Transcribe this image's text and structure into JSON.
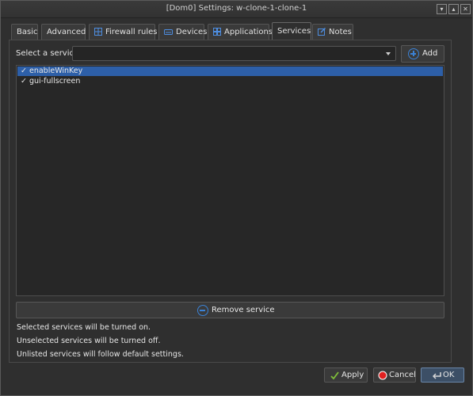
{
  "window": {
    "title": "[Dom0] Settings: w-clone-1-clone-1",
    "controls": [
      "minimize-icon",
      "maximize-icon",
      "close-icon"
    ]
  },
  "tabs": [
    {
      "label": "Basic",
      "icon": null
    },
    {
      "label": "Advanced",
      "icon": null
    },
    {
      "label": "Firewall rules",
      "icon": "firewall-icon"
    },
    {
      "label": "Devices",
      "icon": "devices-icon"
    },
    {
      "label": "Applications",
      "icon": "applications-icon"
    },
    {
      "label": "Services",
      "icon": null,
      "active": true
    },
    {
      "label": "Notes",
      "icon": "notes-icon"
    }
  ],
  "services": {
    "select_label": "Select a service:",
    "select_value": "",
    "add_label": "Add",
    "items": [
      {
        "name": "enableWinKey",
        "checked": true,
        "selected": true
      },
      {
        "name": "gui-fullscreen",
        "checked": true,
        "selected": false
      }
    ],
    "remove_label": "Remove service",
    "info": [
      "Selected services will be turned on.",
      "Unselected services will be turned off.",
      "Unlisted services will follow default settings."
    ]
  },
  "footer": {
    "apply_label": "Apply",
    "cancel_label": "Cancel",
    "ok_label": "OK"
  },
  "colors": {
    "accent": "#3b82d6",
    "selection": "#2d5fa8",
    "cancel_icon": "#e02020",
    "apply_icon": "#7fbf3a"
  }
}
